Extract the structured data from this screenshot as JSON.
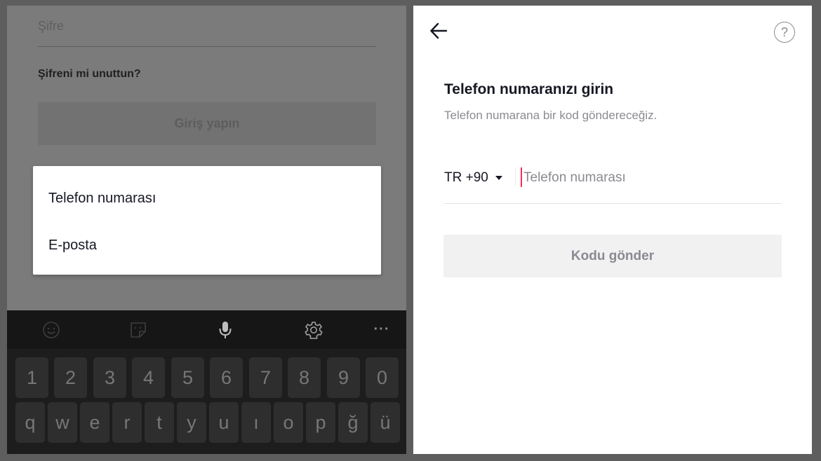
{
  "login_screen": {
    "password_label": "Şifre",
    "forgot_password": "Şifreni mi unuttun?",
    "login_button": "Giriş yapın"
  },
  "method_menu": {
    "items": [
      {
        "label": "Telefon numarası"
      },
      {
        "label": "E-posta"
      }
    ]
  },
  "keyboard": {
    "toolbar_icons": [
      "emoji-icon",
      "sticker-icon",
      "microphone-icon",
      "gear-icon",
      "more-icon"
    ],
    "more_label": "···",
    "number_row": [
      "1",
      "2",
      "3",
      "4",
      "5",
      "6",
      "7",
      "8",
      "9",
      "0"
    ],
    "letter_row": [
      "q",
      "w",
      "e",
      "r",
      "t",
      "y",
      "u",
      "ı",
      "o",
      "p",
      "ğ",
      "ü"
    ]
  },
  "phone_screen": {
    "icons": {
      "back": "back-arrow-icon",
      "help": "help-circle-icon"
    },
    "help_glyph": "?",
    "title": "Telefon numaranızı girin",
    "subtitle": "Telefon numarana bir kod göndereceğiz.",
    "country_code": "TR +90",
    "phone_value": "",
    "phone_placeholder": "Telefon numarası",
    "send_button": "Kodu gönder"
  },
  "colors": {
    "accent": "#fe2c55",
    "text_primary": "#161823",
    "text_secondary": "#8a8b91",
    "button_disabled_bg": "#f1f1f2"
  }
}
